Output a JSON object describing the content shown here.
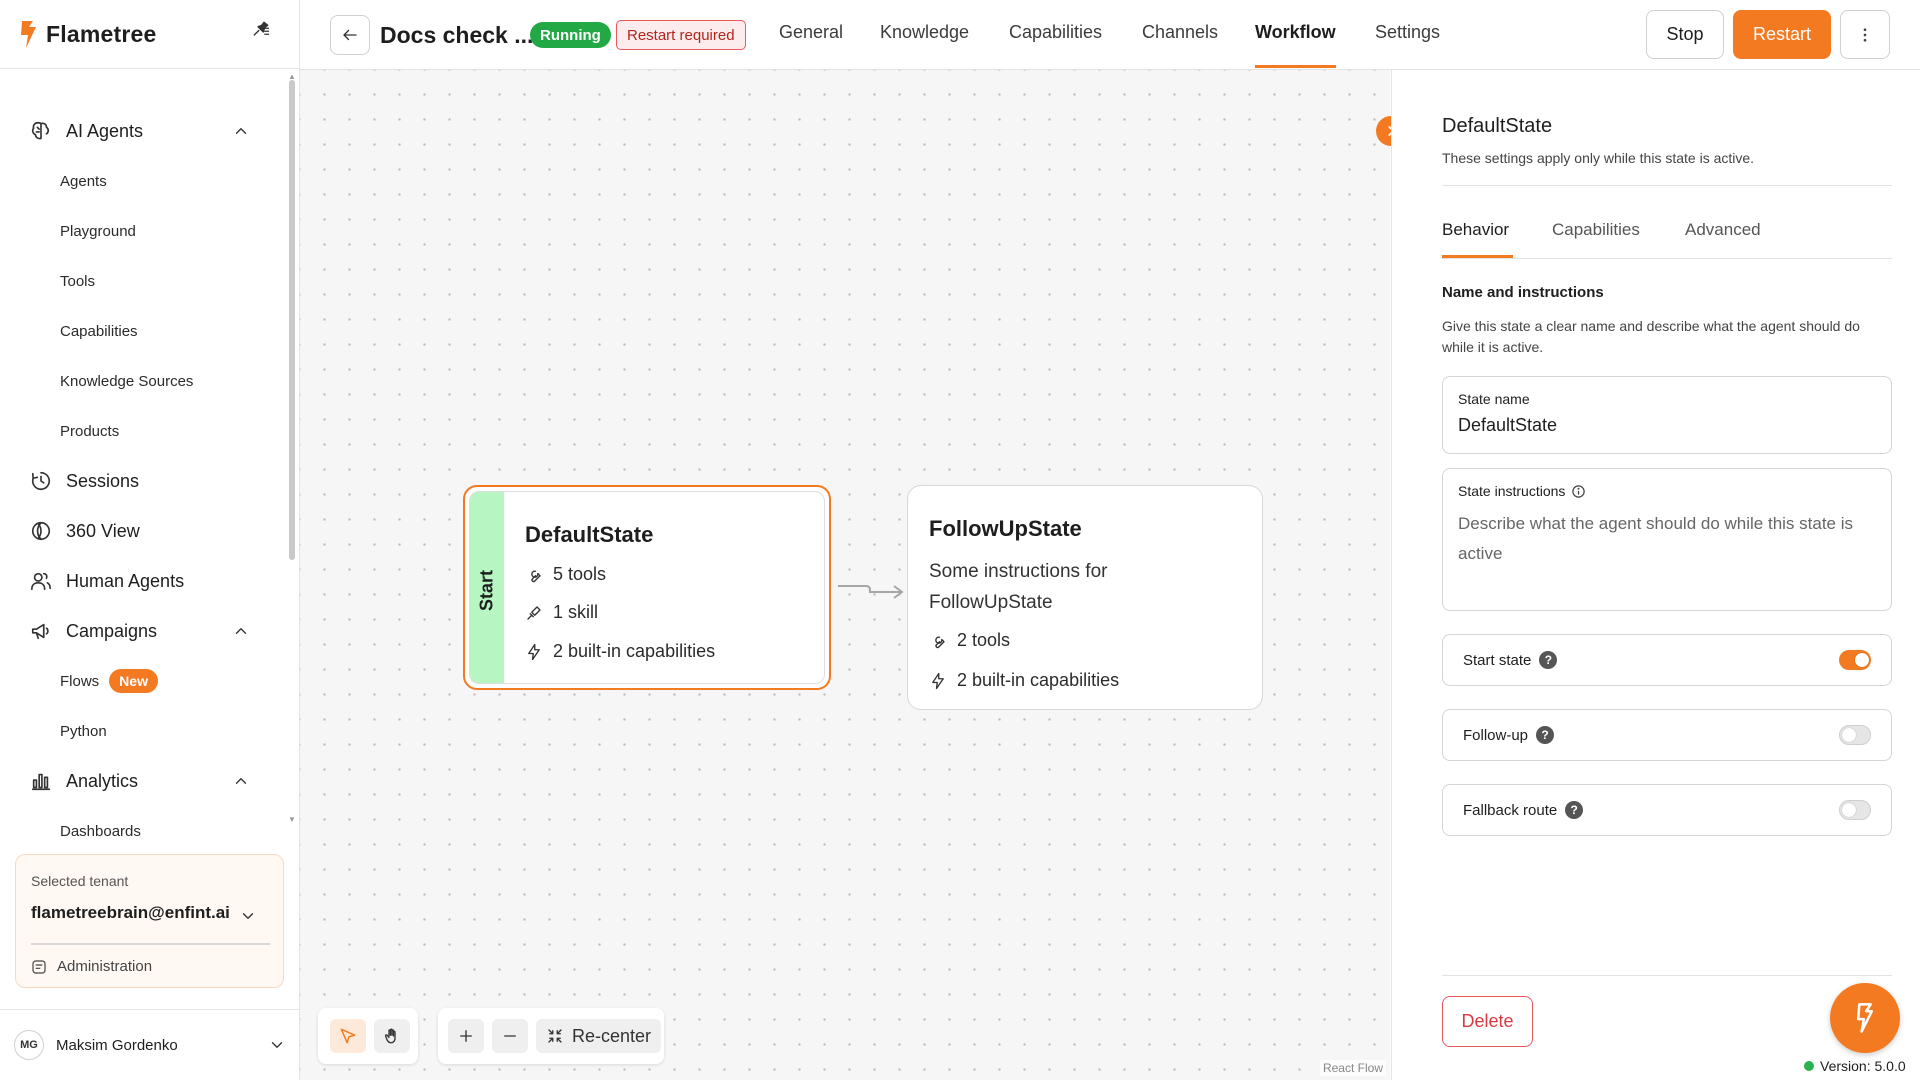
{
  "brand": {
    "name": "Flametree",
    "accent": "#f47a22"
  },
  "sidebar": {
    "sections": [
      {
        "label": "AI Agents",
        "icon": "brain-icon",
        "expanded": true,
        "items": [
          "Agents",
          "Playground",
          "Tools",
          "Capabilities",
          "Knowledge Sources",
          "Products"
        ]
      },
      {
        "label": "Sessions",
        "icon": "clock-icon"
      },
      {
        "label": "360 View",
        "icon": "globe-icon"
      },
      {
        "label": "Human Agents",
        "icon": "users-icon"
      },
      {
        "label": "Campaigns",
        "icon": "megaphone-icon",
        "expanded": true,
        "items": [
          "Flows",
          "Python"
        ],
        "badge": "New"
      },
      {
        "label": "Analytics",
        "icon": "bar-chart-icon",
        "expanded": true,
        "items": [
          "Dashboards"
        ]
      }
    ],
    "tenant": {
      "caption": "Selected tenant",
      "email": "flametreebrain@enfint.ai",
      "admin_label": "Administration"
    },
    "user": {
      "initials": "MG",
      "name": "Maksim Gordenko"
    }
  },
  "header": {
    "title": "Docs check ...",
    "status_running": "Running",
    "status_restart": "Restart required",
    "tabs": [
      "General",
      "Knowledge",
      "Capabilities",
      "Channels",
      "Workflow",
      "Settings"
    ],
    "active_tab": "Workflow",
    "stop_label": "Stop",
    "restart_label": "Restart"
  },
  "canvas": {
    "nodes": [
      {
        "title": "DefaultState",
        "start_label": "Start",
        "rows": [
          "5 tools",
          "1 skill",
          "2 built-in capabilities"
        ]
      },
      {
        "title": "FollowUpState",
        "instructions_line1": "Some instructions for",
        "instructions_line2": "FollowUpState",
        "rows": [
          "2 tools",
          "2 built-in capabilities"
        ]
      }
    ],
    "recenter_label": "Re-center",
    "attribution": "React Flow"
  },
  "panel": {
    "title": "DefaultState",
    "description": "These settings apply only while this state is active.",
    "tabs": [
      "Behavior",
      "Capabilities",
      "Advanced"
    ],
    "section_title": "Name and instructions",
    "section_desc": "Give this state a clear name and describe what the agent should do while it is active.",
    "state_name_label": "State name",
    "state_name_value": "DefaultState",
    "instructions_label": "State instructions",
    "instructions_placeholder": "Describe what the agent should do while this state is active",
    "toggles": [
      {
        "label": "Start state",
        "on": true
      },
      {
        "label": "Follow-up",
        "on": false
      },
      {
        "label": "Fallback route",
        "on": false
      }
    ],
    "delete_label": "Delete"
  },
  "version": "Version: 5.0.0"
}
